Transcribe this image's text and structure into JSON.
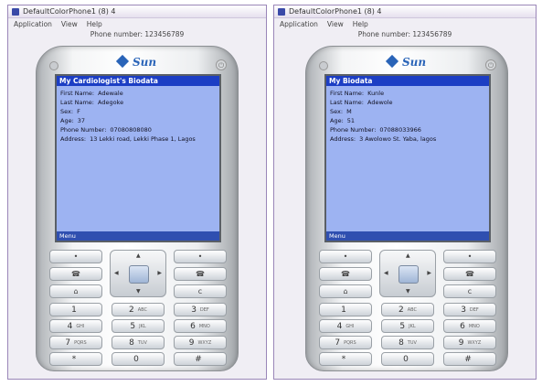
{
  "windows": [
    {
      "title": "DefaultColorPhone1 (8) 4",
      "menu": [
        "Application",
        "View",
        "Help"
      ],
      "phone_number": "Phone number: 123456789",
      "brand": "Sun",
      "screen": {
        "title": "My Cardiologist's Biodata",
        "fields": [
          {
            "label": "First Name:",
            "value": "Adewale"
          },
          {
            "label": "Last Name:",
            "value": "Adegoke"
          },
          {
            "label": "Sex:",
            "value": "F"
          },
          {
            "label": "Age:",
            "value": "37"
          },
          {
            "label": "Phone Number:",
            "value": "07080808080"
          },
          {
            "label": "Address:",
            "value": "13 Lekki road, Lekki Phase 1, Lagos"
          }
        ],
        "softkey": "Menu"
      }
    },
    {
      "title": "DefaultColorPhone1 (8) 4",
      "menu": [
        "Application",
        "View",
        "Help"
      ],
      "phone_number": "Phone number: 123456789",
      "brand": "Sun",
      "screen": {
        "title": "My Biodata",
        "fields": [
          {
            "label": "First Name:",
            "value": "Kunle"
          },
          {
            "label": "Last Name:",
            "value": "Adewole"
          },
          {
            "label": "Sex:",
            "value": "M"
          },
          {
            "label": "Age:",
            "value": "51"
          },
          {
            "label": "Phone Number:",
            "value": "07088033966"
          },
          {
            "label": "Address:",
            "value": "3 Awolowo St. Yaba, lagos"
          }
        ],
        "softkey": "Menu"
      }
    }
  ],
  "keypad": {
    "soft_left": "•",
    "soft_right": "•",
    "call": "☎",
    "end": "☎",
    "home": "⌂",
    "clear": "c",
    "keys": [
      {
        "digit": "1",
        "letters": ""
      },
      {
        "digit": "2",
        "letters": "ABC"
      },
      {
        "digit": "3",
        "letters": "DEF"
      },
      {
        "digit": "4",
        "letters": "GHI"
      },
      {
        "digit": "5",
        "letters": "JKL"
      },
      {
        "digit": "6",
        "letters": "MNO"
      },
      {
        "digit": "7",
        "letters": "PQRS"
      },
      {
        "digit": "8",
        "letters": "TUV"
      },
      {
        "digit": "9",
        "letters": "WXYZ"
      },
      {
        "digit": "*",
        "letters": ""
      },
      {
        "digit": "0",
        "letters": ""
      },
      {
        "digit": "#",
        "letters": ""
      }
    ]
  },
  "colors": {
    "screen_bg": "#9db3f2",
    "title_bar": "#1c3ec4",
    "brand": "#2a64b8"
  }
}
